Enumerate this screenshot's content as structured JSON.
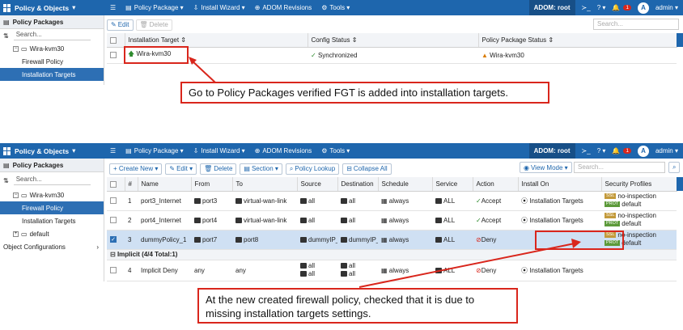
{
  "top": {
    "app_title": "Policy & Objects",
    "menu": [
      {
        "icon": "menu-icon",
        "glyph": "☰",
        "label": ""
      },
      {
        "icon": "package-icon",
        "glyph": "▤",
        "label": "Policy Package ▾"
      },
      {
        "icon": "wizard-icon",
        "glyph": "⇩",
        "label": "Install Wizard ▾"
      },
      {
        "icon": "globe-icon",
        "glyph": "⊕",
        "label": "ADOM Revisions"
      },
      {
        "icon": "tools-icon",
        "glyph": "⚙",
        "label": "Tools ▾"
      }
    ],
    "adom": "ADOM: root",
    "cli_glyph": "≻_",
    "help_glyph": "? ▾",
    "bell_glyph": "🔔",
    "notif_count": "1",
    "avatar_letter": "A",
    "user": "admin ▾"
  },
  "shot1": {
    "sidebar": {
      "header": "Policy Packages",
      "search_placeholder": "Search...",
      "items": [
        {
          "label": "Wira-kvm30",
          "type": "folder"
        },
        {
          "label": "Firewall Policy",
          "type": "child"
        },
        {
          "label": "Installation Targets",
          "type": "child",
          "active": true
        }
      ]
    },
    "toolbar": {
      "edit": "Edit",
      "delete": "Delete",
      "search_placeholder": "Search..."
    },
    "columns": [
      "Installation Target ⇕",
      "Config Status ⇕",
      "Policy Package Status ⇕"
    ],
    "rows": [
      {
        "target": "Wira-kvm30",
        "config": "Synchronized",
        "pkg_status": "Wira-kvm30"
      }
    ],
    "callout": "Go to Policy Packages verified FGT is added into installation targets."
  },
  "shot2": {
    "sidebar": {
      "header": "Policy Packages",
      "search_placeholder": "Search...",
      "items": [
        {
          "label": "Wira-kvm30",
          "type": "folder"
        },
        {
          "label": "Firewall Policy",
          "type": "child",
          "active": true
        },
        {
          "label": "Installation Targets",
          "type": "child"
        },
        {
          "label": "default",
          "type": "folder-plus"
        },
        {
          "label": "Object Configurations",
          "type": "section"
        }
      ]
    },
    "toolbar": {
      "create": "+ Create New ▾",
      "edit": "Edit ▾",
      "delete": "Delete",
      "section": "Section ▾",
      "lookup": "Policy Lookup",
      "collapse": "Collapse All",
      "view_mode": "View Mode ▾",
      "search_placeholder": "Search..."
    },
    "columns": [
      "",
      "#",
      "Name",
      "From",
      "To",
      "Source",
      "Destination",
      "Schedule",
      "Service",
      "Action",
      "Install On",
      "Security Profiles"
    ],
    "rows": [
      {
        "num": "1",
        "name": "port3_Internet",
        "from": "port3",
        "to": "virtual-wan-link",
        "source": "all",
        "dest": "all",
        "schedule": "always",
        "service": "ALL",
        "action": "Accept",
        "install": "Installation Targets",
        "ssl": "SSL",
        "ssl_text": "no-inspection",
        "prot": "PROT",
        "prot_text": "default",
        "selected": false
      },
      {
        "num": "2",
        "name": "port4_Internet",
        "from": "port4",
        "to": "virtual-wan-link",
        "source": "all",
        "dest": "all",
        "schedule": "always",
        "service": "ALL",
        "action": "Accept",
        "install": "Installation Targets",
        "ssl": "SSL",
        "ssl_text": "no-inspection",
        "prot": "PROT",
        "prot_text": "default",
        "selected": false
      },
      {
        "num": "3",
        "name": "dummyPolicy_1",
        "from": "port7",
        "to": "port8",
        "source": "dummyIP_",
        "dest": "dummyIP_",
        "schedule": "always",
        "service": "ALL",
        "action": "Deny",
        "install": "",
        "ssl": "SSL",
        "ssl_text": "no-inspection",
        "prot": "PROT",
        "prot_text": "default",
        "selected": true
      }
    ],
    "implicit_label": "Implicit (4/4 Total:1)",
    "implicit_row": {
      "num": "4",
      "name": "Implicit Deny",
      "from": "any",
      "to": "any",
      "source": [
        "all",
        "all"
      ],
      "dest": [
        "all",
        "all"
      ],
      "schedule": "always",
      "service": "ALL",
      "action": "Deny",
      "install": "Installation Targets"
    },
    "callout": "At the new created firewall policy, checked that it is due to missing installation targets settings."
  },
  "colors": {
    "topbar": "#1e66ad",
    "selected": "#2d6fb4",
    "callout_border": "#d9261c"
  }
}
